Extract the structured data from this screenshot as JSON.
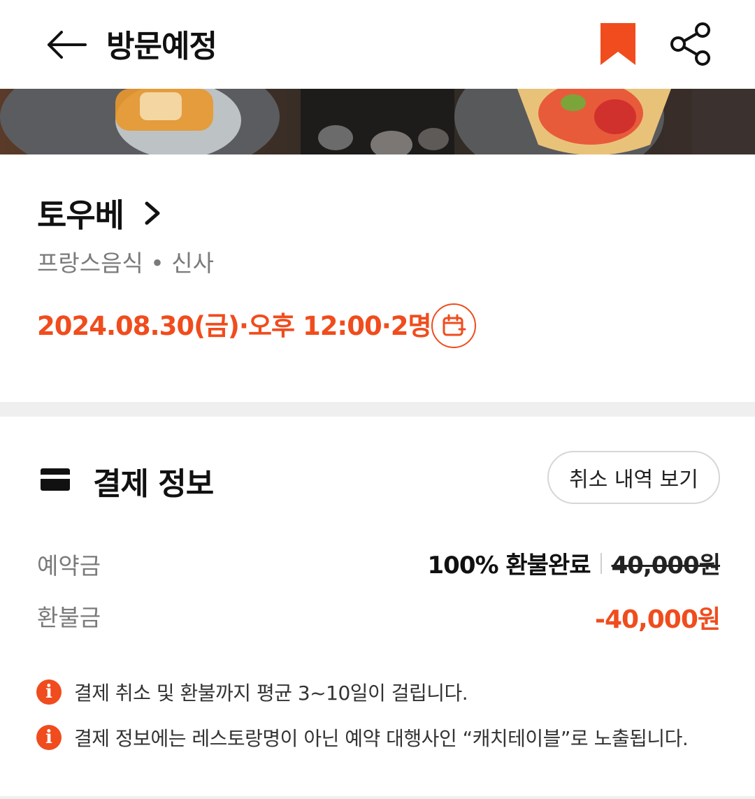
{
  "header": {
    "title": "방문예정",
    "icons": {
      "back": "arrow-left-icon",
      "bookmark": "bookmark-icon",
      "share": "share-icon"
    },
    "bookmark_color": "#f04c1d"
  },
  "restaurant": {
    "name": "토우베",
    "meta": "프랑스음식 • 신사",
    "reservation": "2024.08.30(금)·오후 12:00·2명"
  },
  "payment": {
    "title": "결제 정보",
    "history_button": "취소 내역 보기",
    "deposit_label": "예약금",
    "refund_status": "100% 환불완료",
    "original_amount": "40,000원",
    "refund_label": "환불금",
    "refund_amount": "-40,000원"
  },
  "notices": [
    "결제 취소 및 환불까지 평균 3~10일이 걸립니다.",
    "결제 정보에는 레스토랑명이 아닌 예약 대행사인 “캐치테이블”로 노출됩니다."
  ],
  "colors": {
    "accent": "#f04c1d",
    "muted": "#7a7a7a"
  }
}
